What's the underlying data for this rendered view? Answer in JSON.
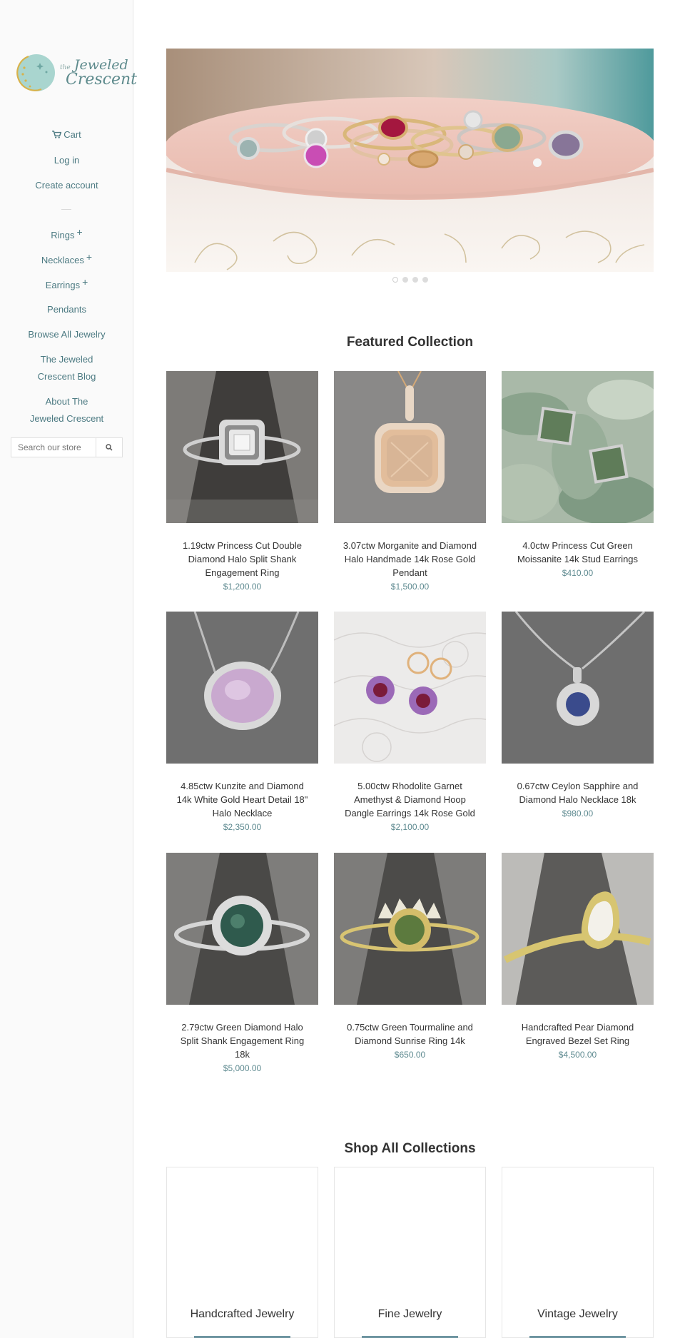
{
  "brand": {
    "logo_alt": "the Jeweled Crescent",
    "logo_the": "the",
    "logo_line1": "Jeweled",
    "logo_line2": "Crescent"
  },
  "sidebar": {
    "cart_label": "Cart",
    "login_label": "Log in",
    "create_account_label": "Create account",
    "menu": [
      {
        "label": "Rings",
        "expandable": true
      },
      {
        "label": "Necklaces",
        "expandable": true
      },
      {
        "label": "Earrings",
        "expandable": true
      },
      {
        "label": "Pendants",
        "expandable": false
      },
      {
        "label": "Browse All Jewelry",
        "expandable": false
      },
      {
        "label": "The Jeweled Crescent Blog",
        "expandable": false
      },
      {
        "label": "About The Jeweled Crescent",
        "expandable": false
      }
    ],
    "search_placeholder": "Search our store",
    "plus_symbol": "+"
  },
  "hero": {
    "slide_count": 4,
    "active_slide": 1
  },
  "featured": {
    "title": "Featured Collection",
    "products": [
      {
        "name": "1.19ctw Princess Cut Double Diamond Halo Split Shank Engagement Ring",
        "price": "$1,200.00"
      },
      {
        "name": "3.07ctw Morganite and Diamond Halo Handmade 14k Rose Gold Pendant",
        "price": "$1,500.00"
      },
      {
        "name": "4.0ctw Princess Cut Green Moissanite 14k Stud Earrings",
        "price": "$410.00"
      },
      {
        "name": "4.85ctw Kunzite and Diamond 14k White Gold Heart Detail 18\" Halo Necklace",
        "price": "$2,350.00"
      },
      {
        "name": "5.00ctw Rhodolite Garnet Amethyst & Diamond Hoop Dangle Earrings 14k Rose Gold",
        "price": "$2,100.00"
      },
      {
        "name": "0.67ctw Ceylon Sapphire and Diamond Halo Necklace 18k",
        "price": "$980.00"
      },
      {
        "name": "2.79ctw Green Diamond Halo Split Shank Engagement Ring 18k",
        "price": "$5,000.00"
      },
      {
        "name": "0.75ctw Green Tourmaline and Diamond Sunrise Ring 14k",
        "price": "$650.00"
      },
      {
        "name": "Handcrafted Pear Diamond Engraved Bezel Set Ring",
        "price": "$4,500.00"
      }
    ]
  },
  "collections": {
    "title": "Shop All Collections",
    "items": [
      {
        "name": "Handcrafted Jewelry"
      },
      {
        "name": "Fine Jewelry"
      },
      {
        "name": "Vintage Jewelry"
      }
    ]
  },
  "colors": {
    "accent": "#5e8a90",
    "link": "#4c7a82",
    "sidebar_bg": "#fafafa",
    "button": "#6d94a0"
  }
}
